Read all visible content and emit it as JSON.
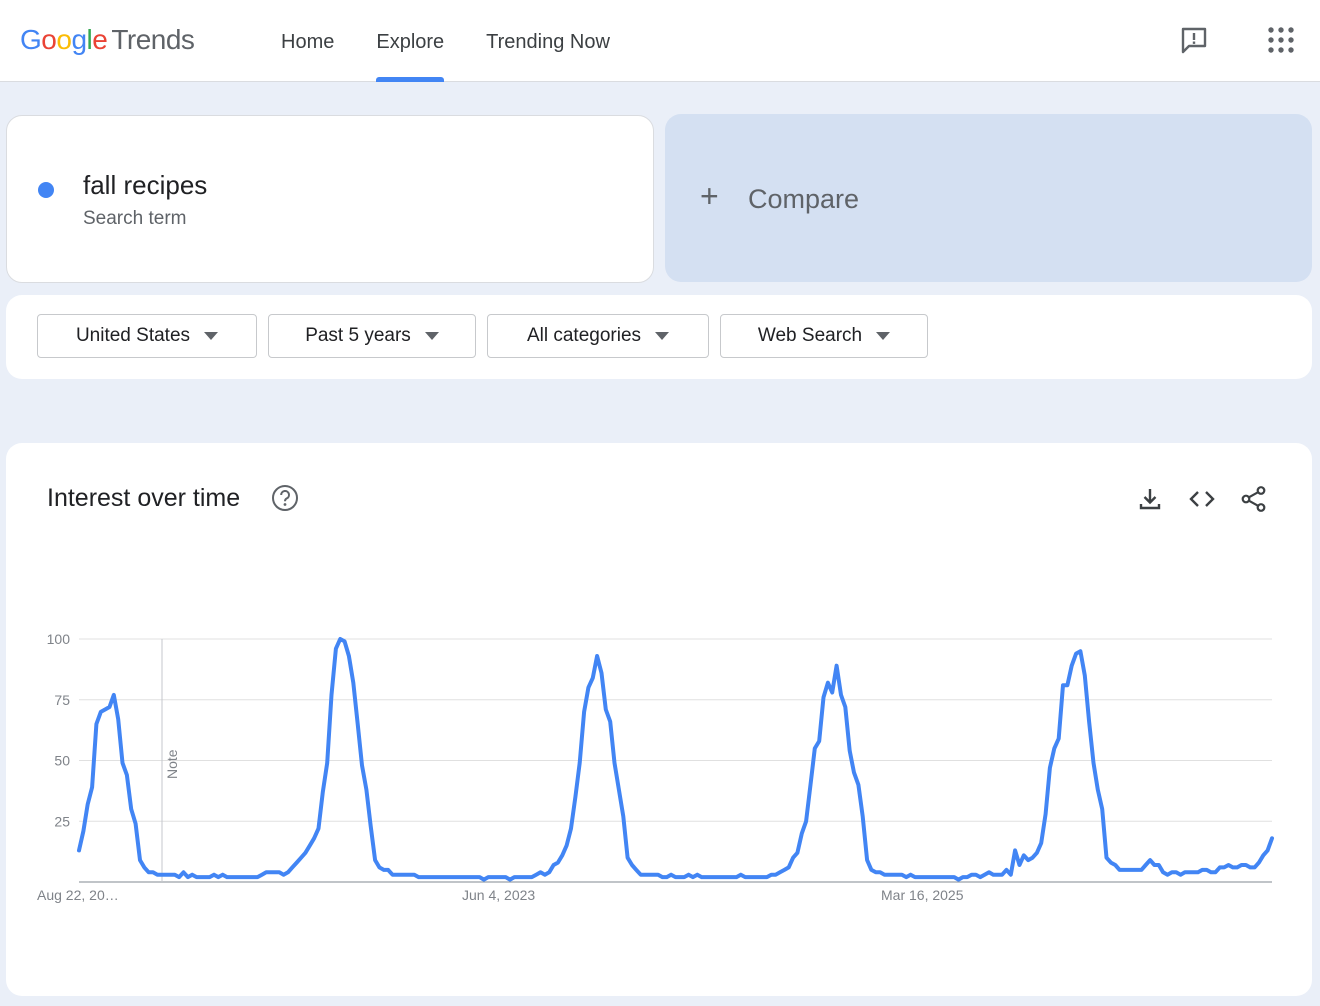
{
  "header": {
    "logo_google": "Google",
    "logo_trends": "Trends",
    "nav": [
      {
        "label": "Home",
        "active": false
      },
      {
        "label": "Explore",
        "active": true
      },
      {
        "label": "Trending Now",
        "active": false
      }
    ],
    "icons": [
      "feedback-icon",
      "apps-grid-icon"
    ]
  },
  "search": {
    "term": "fall recipes",
    "term_type": "Search term",
    "term_color": "#4285f4",
    "compare_label": "Compare"
  },
  "filters": {
    "region": "United States",
    "time_range": "Past 5 years",
    "category": "All categories",
    "search_type": "Web Search"
  },
  "chart_card": {
    "title": "Interest over time",
    "icons": [
      "help-icon",
      "download-icon",
      "embed-code-icon",
      "share-icon"
    ],
    "note_label": "Note"
  },
  "chart_data": {
    "type": "line",
    "series": [
      {
        "color": "#4285f4",
        "values": [
          13,
          21,
          32,
          39,
          65,
          70,
          71,
          72,
          77,
          67,
          49,
          44,
          30,
          24,
          9,
          6,
          4,
          4,
          3,
          3,
          3,
          3,
          3,
          2,
          4,
          2,
          3,
          2,
          2,
          2,
          2,
          3,
          2,
          3,
          2,
          2,
          2,
          2,
          2,
          2,
          2,
          2,
          3,
          4,
          4,
          4,
          4,
          3,
          4,
          6,
          8,
          10,
          12,
          15,
          18,
          22,
          37,
          49,
          77,
          96,
          100,
          99,
          93,
          82,
          65,
          48,
          38,
          23,
          9,
          6,
          5,
          5,
          3,
          3,
          3,
          3,
          3,
          3,
          2,
          2,
          2,
          2,
          2,
          2,
          2,
          2,
          2,
          2,
          2,
          2,
          2,
          2,
          2,
          1,
          2,
          2,
          2,
          2,
          2,
          1,
          2,
          2,
          2,
          2,
          2,
          3,
          4,
          3,
          4,
          7,
          8,
          11,
          15,
          22,
          35,
          49,
          70,
          80,
          84,
          93,
          86,
          71,
          66,
          49,
          38,
          27,
          10,
          7,
          5,
          3,
          3,
          3,
          3,
          3,
          2,
          2,
          3,
          2,
          2,
          2,
          3,
          2,
          3,
          2,
          2,
          2,
          2,
          2,
          2,
          2,
          2,
          2,
          3,
          2,
          2,
          2,
          2,
          2,
          2,
          3,
          3,
          4,
          5,
          6,
          10,
          12,
          20,
          25,
          40,
          55,
          58,
          76,
          82,
          78,
          89,
          77,
          72,
          54,
          45,
          40,
          27,
          9,
          5,
          4,
          4,
          3,
          3,
          3,
          3,
          3,
          2,
          3,
          2,
          2,
          2,
          2,
          2,
          2,
          2,
          2,
          2,
          2,
          1,
          2,
          2,
          3,
          3,
          2,
          3,
          4,
          3,
          3,
          3,
          5,
          3,
          13,
          7,
          11,
          9,
          10,
          12,
          16,
          28,
          47,
          55,
          59,
          81,
          81,
          89,
          94,
          95,
          85,
          66,
          49,
          38,
          30,
          10,
          8,
          7,
          5,
          5,
          5,
          5,
          5,
          5,
          7,
          9,
          7,
          7,
          4,
          3,
          4,
          4,
          3,
          4,
          4,
          4,
          4,
          5,
          5,
          4,
          4,
          6,
          6,
          7,
          6,
          6,
          7,
          7,
          6,
          6,
          8,
          11,
          13,
          18
        ]
      }
    ],
    "x_tick_labels": [
      "Aug 22, 20…",
      "Jun 4, 2023",
      "Mar 16, 2025"
    ],
    "y_tick_labels": [
      "100",
      "75",
      "50",
      "25"
    ],
    "ylim": [
      0,
      100
    ],
    "grid": true
  }
}
